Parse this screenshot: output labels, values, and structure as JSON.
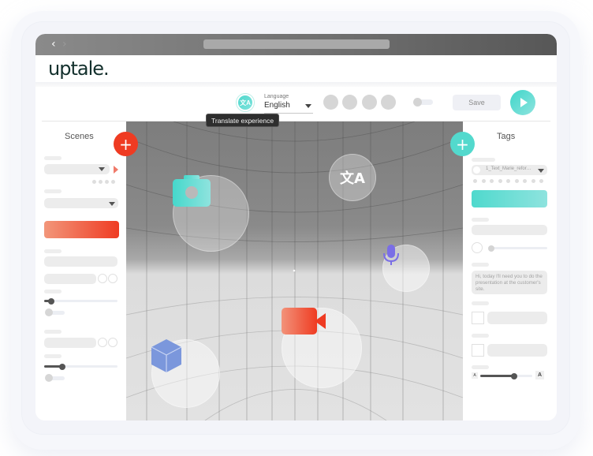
{
  "browser": {
    "back_icon": "‹",
    "forward_icon": "›"
  },
  "app": {
    "logo": "uptale."
  },
  "toolbar": {
    "translate_icon": "文A",
    "language_label": "Language",
    "language_value": "English",
    "save_label": "Save",
    "tooltip": "Translate experience"
  },
  "left_panel": {
    "title": "Scenes",
    "add_icon": "+",
    "slider1_value": 0.1,
    "slider2_value": 0.25
  },
  "right_panel": {
    "title": "Tags",
    "add_icon": "+",
    "tag_select_value": "1_Text_Marie_refor…",
    "message_text": "Hi, today I'll need you to do the presentation at the customer's site.",
    "font_size_small": "A",
    "font_size_large": "A",
    "font_slider_value": 0.65
  },
  "viewport": {
    "bubbles": [
      {
        "name": "camera-bubble",
        "icon": "camera-icon"
      },
      {
        "name": "translate-bubble",
        "icon": "translate-icon"
      },
      {
        "name": "microphone-bubble",
        "icon": "microphone-icon"
      },
      {
        "name": "video-bubble",
        "icon": "video-camera-icon"
      },
      {
        "name": "3d-object-bubble",
        "icon": "cube-icon"
      }
    ]
  },
  "colors": {
    "accent_teal": "#4fd9cd",
    "accent_red": "#ef3b22",
    "mic_purple": "#7a6ee6",
    "cube_blue": "#7b97dc"
  }
}
